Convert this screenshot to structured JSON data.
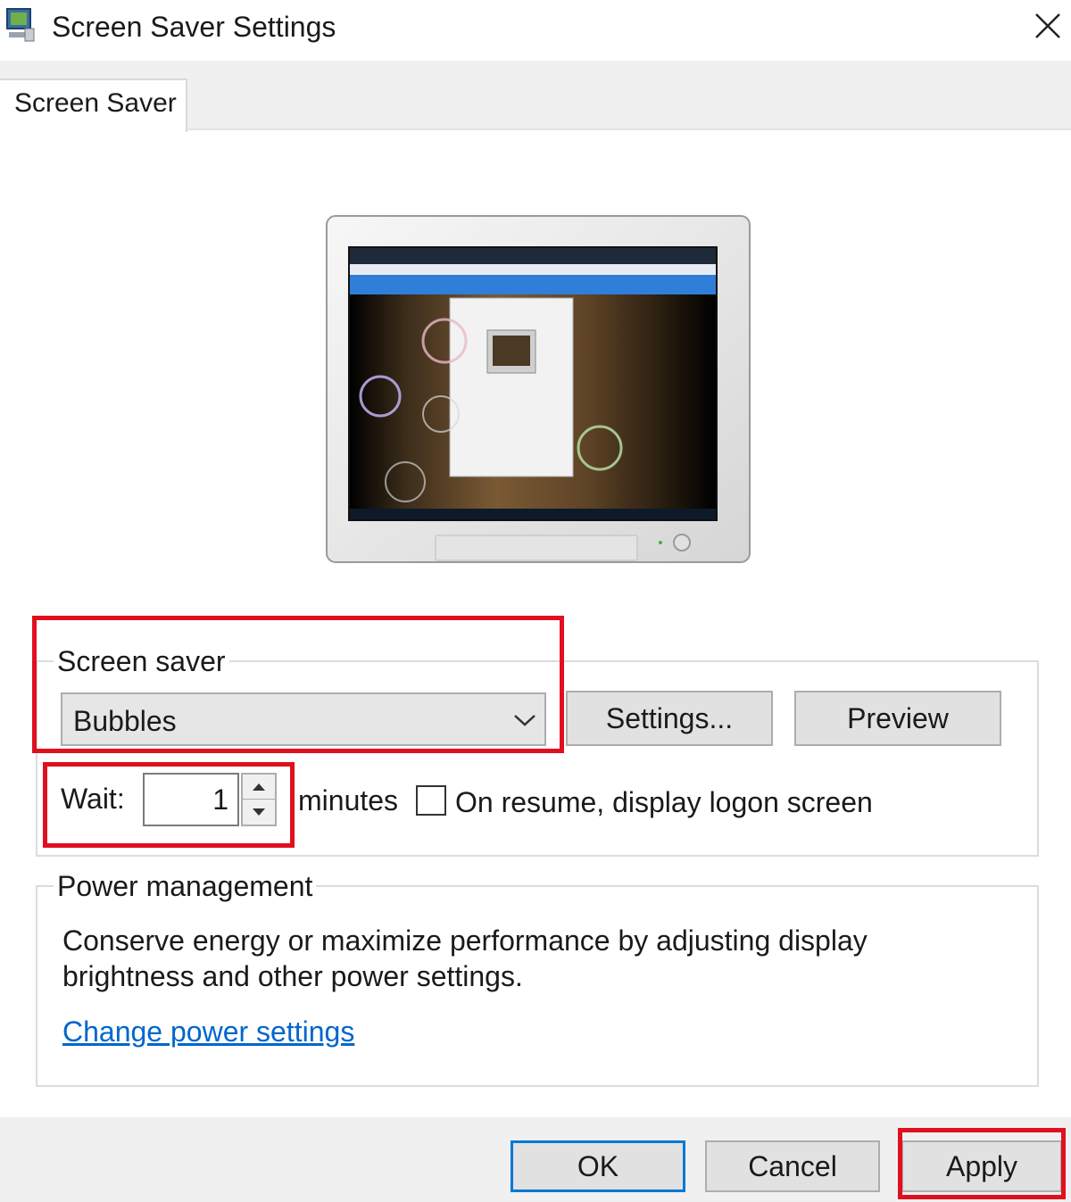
{
  "window": {
    "title": "Screen Saver Settings",
    "icon": "screen-saver-settings-icon",
    "close_icon": "close-icon"
  },
  "tabs": [
    {
      "label": "Screen Saver",
      "active": true
    }
  ],
  "preview": {
    "image": "monitor-preview-bubbles"
  },
  "screen_saver": {
    "group_label": "Screen saver",
    "selected": "Bubbles",
    "settings_label": "Settings...",
    "preview_label": "Preview",
    "wait_label": "Wait:",
    "wait_value": "1",
    "minutes_label": "minutes",
    "logon_label": "On resume, display logon screen",
    "logon_checked": false
  },
  "power": {
    "group_label": "Power management",
    "description_line1": "Conserve energy or maximize performance by adjusting display",
    "description_line2": "brightness and other power settings.",
    "link_label": "Change power settings"
  },
  "footer": {
    "ok_label": "OK",
    "cancel_label": "Cancel",
    "apply_label": "Apply"
  },
  "colors": {
    "highlight": "#e0101e",
    "link": "#0066cc",
    "default_button_border": "#0078d7"
  }
}
